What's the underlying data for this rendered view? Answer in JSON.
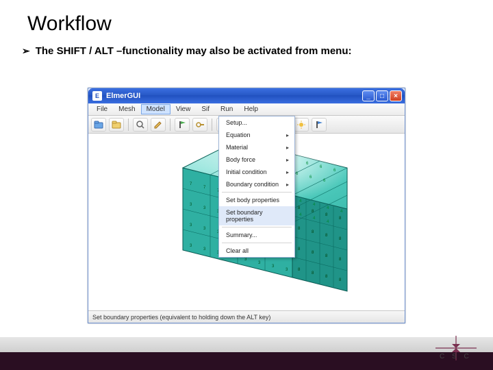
{
  "slide": {
    "title": "Workflow",
    "bullet_glyph": "➢",
    "bullet_text": "The SHIFT / ALT –functionality may also be activated from menu:"
  },
  "window": {
    "title": "ElmerGUI",
    "btn_min": "_",
    "btn_max": "□",
    "btn_close": "×"
  },
  "menubar": {
    "items": [
      "File",
      "Mesh",
      "Model",
      "View",
      "Sif",
      "Run",
      "Help"
    ],
    "open_index": 2
  },
  "toolbar": {
    "icons": [
      "open",
      "folder",
      "sep",
      "magnifier",
      "pencil",
      "sep",
      "flag-green",
      "key",
      "sep",
      "x-red",
      "x-red2",
      "arrows-h",
      "arrows-h2",
      "sep",
      "sun",
      "flag-blue"
    ]
  },
  "dropdown": {
    "items": [
      {
        "label": "Setup...",
        "arrow": false,
        "hl": false
      },
      {
        "label": "Equation",
        "arrow": true,
        "hl": false
      },
      {
        "label": "Material",
        "arrow": true,
        "hl": false
      },
      {
        "label": "Body force",
        "arrow": true,
        "hl": false
      },
      {
        "label": "Initial condition",
        "arrow": true,
        "hl": false
      },
      {
        "label": "Boundary condition",
        "arrow": true,
        "hl": false
      },
      {
        "sep": true
      },
      {
        "label": "Set body properties",
        "arrow": false,
        "hl": false
      },
      {
        "label": "Set boundary properties",
        "arrow": false,
        "hl": true
      },
      {
        "sep": true
      },
      {
        "label": "Summary...",
        "arrow": false,
        "hl": false
      },
      {
        "sep": true
      },
      {
        "label": "Clear all",
        "arrow": false,
        "hl": false
      }
    ]
  },
  "statusbar": {
    "text": "Set boundary properties (equivalent to holding down the ALT key)"
  },
  "footer": {
    "csc": "C S C"
  }
}
